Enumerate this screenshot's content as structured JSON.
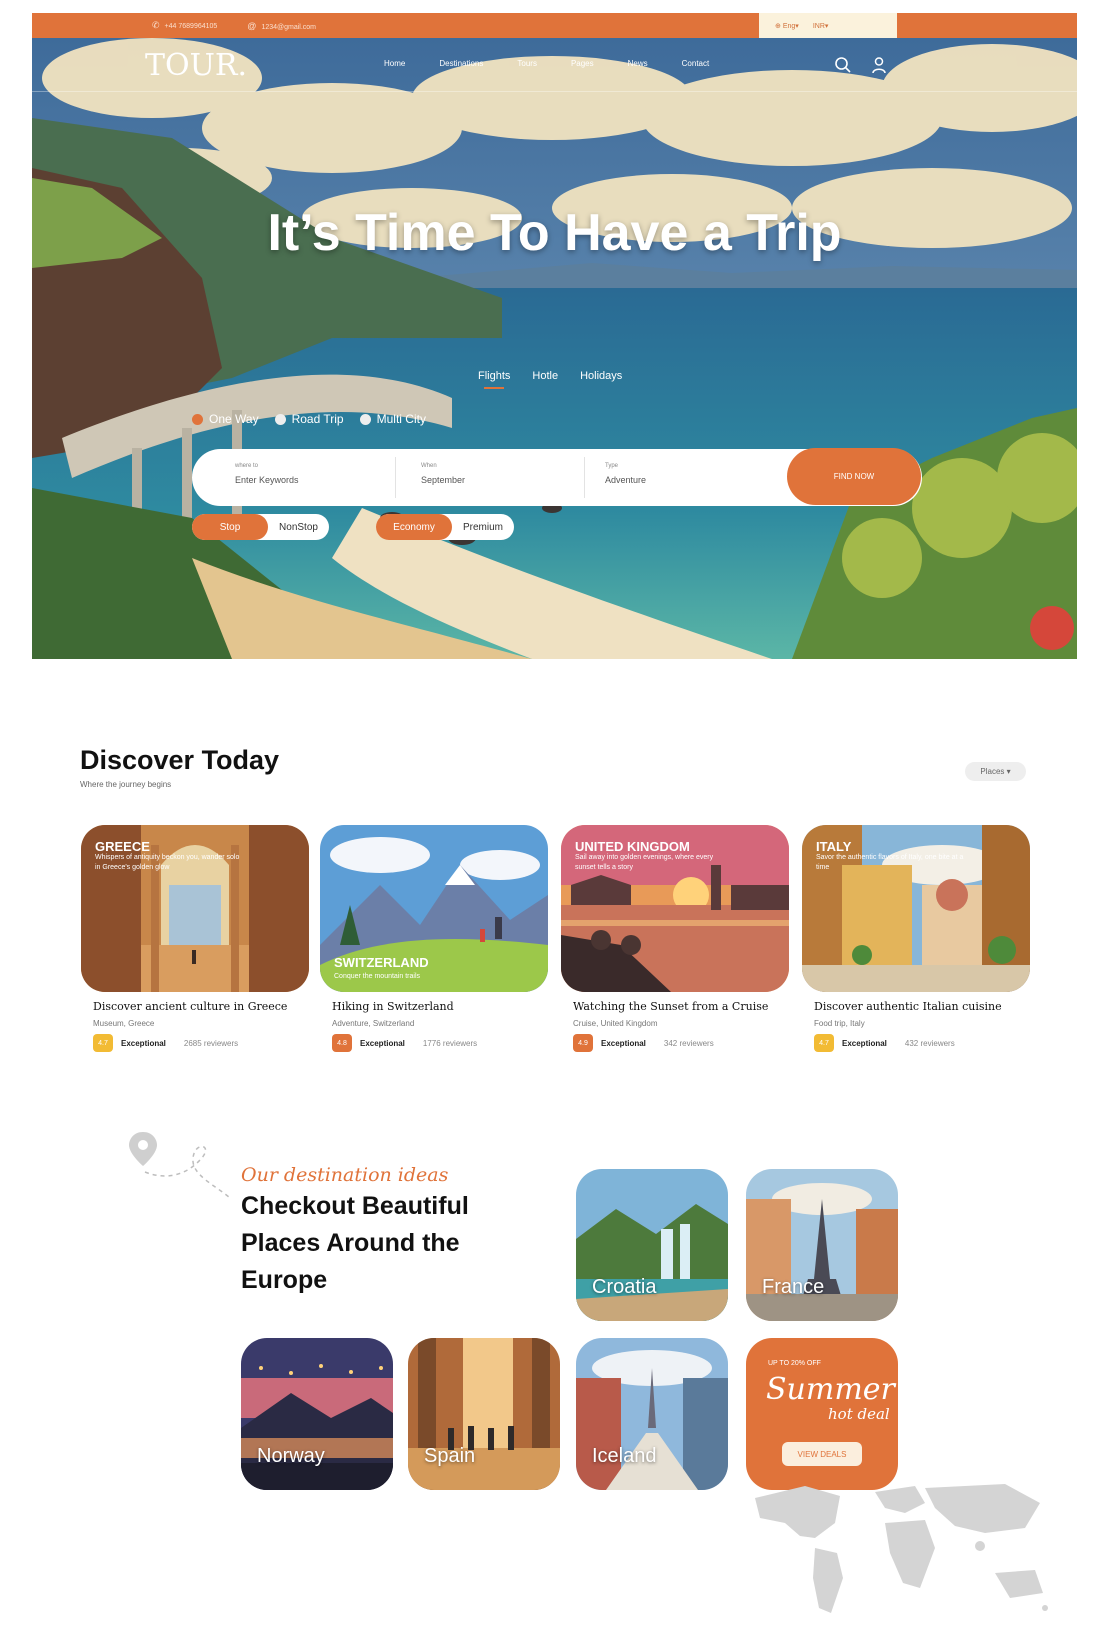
{
  "topbar": {
    "phone": "+44 7689964105",
    "email": "1234@gmail.com",
    "language": "Eng",
    "currency": "INR"
  },
  "nav": {
    "logo": "TOUR.",
    "links": [
      "Home",
      "Destinations",
      "Tours",
      "Pages",
      "News",
      "Contact"
    ]
  },
  "hero": {
    "title": "It’s Time To Have a Trip",
    "tabs": [
      "Flights",
      "Hotle",
      "Holidays"
    ],
    "active_tab": "Flights",
    "trip_types": [
      "One Way",
      "Road Trip",
      "Multi City"
    ],
    "selected_trip_type": "One Way",
    "search": {
      "where_label": "where to",
      "where_placeholder": "Enter Keywords",
      "when_label": "When",
      "when_value": "September",
      "type_label": "Type",
      "type_value": "Adventure",
      "button": "FIND NOW"
    },
    "stop_toggle": {
      "on": "Stop",
      "off": "NonStop"
    },
    "class_toggle": {
      "on": "Economy",
      "off": "Premium"
    }
  },
  "discover": {
    "title": "Discover Today",
    "subtitle": "Where the journey begins",
    "filter": "Places ▾",
    "cards": [
      {
        "country": "GREECE",
        "overlay": "Whispers of antiquity beckon you, wander solo in Greece's golden glow",
        "title": "Discover ancient culture in Greece",
        "category": "Museum, Greece",
        "score": "4.7",
        "label": "Exceptional",
        "reviews": "2685 reviewers"
      },
      {
        "country": "SWITZERLAND",
        "overlay": "Conquer the mountain trails",
        "title": "Hiking in Switzerland",
        "category": "Adventure, Switzerland",
        "score": "4.8",
        "label": "Exceptional",
        "reviews": "1776 reviewers"
      },
      {
        "country": "UNITED KINGDOM",
        "overlay": "Sail away into golden evenings, where every sunset tells a story",
        "title": "Watching the Sunset from a Cruise",
        "category": "Cruise, United Kingdom",
        "score": "4.9",
        "label": "Exceptional",
        "reviews": "342 reviewers"
      },
      {
        "country": "ITALY",
        "overlay": "Savor the authentic flavors of Italy, one bite at a time",
        "title": "Discover authentic Italian cuisine",
        "category": "Food trip, Italy",
        "score": "4.7",
        "label": "Exceptional",
        "reviews": "432 reviewers"
      }
    ]
  },
  "destinations": {
    "kicker": "Our destination ideas",
    "title": "Checkout Beautiful Places Around the Europe",
    "places": [
      "Croatia",
      "France",
      "Norway",
      "Spain",
      "Iceland"
    ],
    "deal": {
      "kicker": "UP TO 20% OFF",
      "title": "Summer",
      "subtitle": "hot deal",
      "button": "VIEW DEALS"
    }
  },
  "colors": {
    "accent": "#e0733a",
    "cream": "#fbf2dc",
    "badge_yellow": "#f2bb34"
  }
}
